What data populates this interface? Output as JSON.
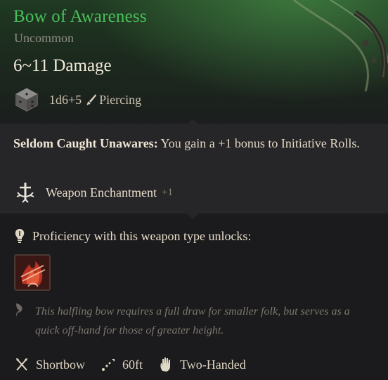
{
  "item": {
    "name": "Bow of Awareness",
    "rarity": "Uncommon",
    "damage": "6~11 Damage",
    "dice": "1d6+5",
    "damage_type": "Piercing",
    "name_color": "#49c05a"
  },
  "passive": {
    "name": "Seldom Caught Unawares:",
    "description": " You gain a +1 bonus to Initiative Rolls."
  },
  "enchantment": {
    "label": "Weapon Enchantment",
    "value": "+1"
  },
  "proficiency": {
    "label": "Proficiency with this weapon type unlocks:",
    "action_icon": "flame-slash-icon"
  },
  "flavor_text": "This halfling bow requires a full draw for smaller folk, but serves as a quick off-hand for those of greater height.",
  "footer": {
    "weapon_type": "Shortbow",
    "range": "60ft",
    "handedness": "Two-Handed"
  }
}
